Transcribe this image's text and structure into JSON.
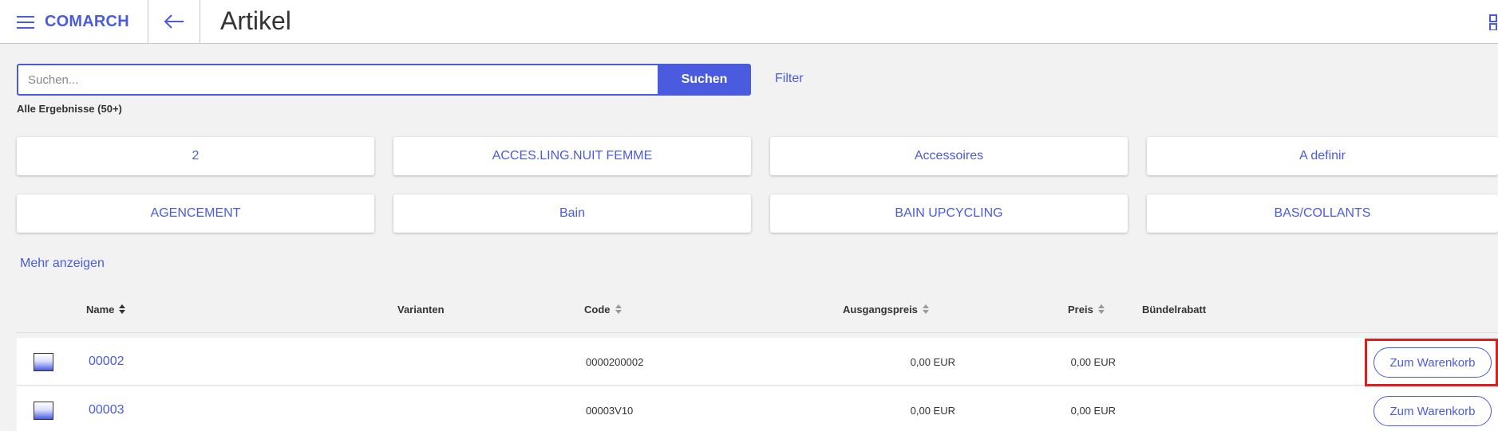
{
  "header": {
    "logo": "COMARCH",
    "title": "Artikel"
  },
  "search": {
    "placeholder": "Suchen...",
    "value": "",
    "button_label": "Suchen",
    "filter_label": "Filter"
  },
  "results": {
    "count_label": "Alle Ergebnisse (50+)"
  },
  "categories": [
    {
      "label": "2"
    },
    {
      "label": "ACCES.LING.NUIT FEMME"
    },
    {
      "label": "Accessoires"
    },
    {
      "label": "A definir"
    },
    {
      "label": "AGENCEMENT"
    },
    {
      "label": "Bain"
    },
    {
      "label": "BAIN UPCYCLING"
    },
    {
      "label": "BAS/COLLANTS"
    }
  ],
  "more_label": "Mehr anzeigen",
  "table": {
    "columns": {
      "name": "Name",
      "variants": "Varianten",
      "code": "Code",
      "base_price": "Ausgangspreis",
      "price": "Preis",
      "bundle": "Bündelrabatt"
    },
    "rows": [
      {
        "name": "00002",
        "variants": "",
        "code": "0000200002",
        "base_price": "0,00 EUR",
        "price": "0,00 EUR",
        "bundle": "",
        "cart_label": "Zum Warenkorb"
      },
      {
        "name": "00003",
        "variants": "",
        "code": "00003V10",
        "base_price": "0,00 EUR",
        "price": "0,00 EUR",
        "bundle": "",
        "cart_label": "Zum Warenkorb"
      }
    ]
  },
  "colors": {
    "accent": "#4a5be0",
    "highlight": "#e01c1c",
    "background": "#f2f2f2"
  }
}
